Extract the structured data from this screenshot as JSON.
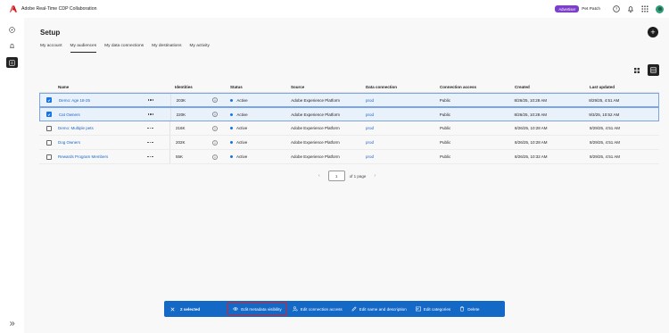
{
  "app": {
    "title": "Adobe Real-Time CDP Collaboration",
    "badge": "Advertiser",
    "org": "Pet Patch"
  },
  "page": {
    "title": "Setup",
    "tabs": [
      "My account",
      "My audiences",
      "My data connections",
      "My destinations",
      "My activity"
    ],
    "active_tab": "My audiences"
  },
  "table": {
    "headers": {
      "name": "Name",
      "identities": "Identities",
      "status": "Status",
      "source": "Source",
      "data_connection": "Data connection",
      "access": "Connection access",
      "created": "Created",
      "updated": "Last updated"
    },
    "rows": [
      {
        "name": "Demo: Age 18-25",
        "identities": "203K",
        "status": "Active",
        "source": "Adobe Experience Platform",
        "conn": "prod",
        "access": "Public",
        "created": "8/26/25, 10:28 AM",
        "updated": "8/29/25, 4:51 AM",
        "selected": true
      },
      {
        "name": "Cat Owners",
        "identities": "220K",
        "status": "Active",
        "source": "Adobe Experience Platform",
        "conn": "prod",
        "access": "Public",
        "created": "8/26/25, 10:28 AM",
        "updated": "9/3/25, 10:52 AM",
        "selected": true
      },
      {
        "name": "Demo: Multiple pets",
        "identities": "216K",
        "status": "Active",
        "source": "Adobe Experience Platform",
        "conn": "prod",
        "access": "Public",
        "created": "8/26/25, 10:28 AM",
        "updated": "8/29/25, 4:51 AM",
        "selected": false
      },
      {
        "name": "Dog Owners",
        "identities": "202K",
        "status": "Active",
        "source": "Adobe Experience Platform",
        "conn": "prod",
        "access": "Public",
        "created": "8/26/25, 10:28 AM",
        "updated": "8/29/25, 4:51 AM",
        "selected": false
      },
      {
        "name": "Rewards Program Members",
        "identities": "55K",
        "status": "Active",
        "source": "Adobe Experience Platform",
        "conn": "prod",
        "access": "Public",
        "created": "8/26/25, 10:32 AM",
        "updated": "8/29/25, 4:51 AM",
        "selected": false
      }
    ]
  },
  "pagination": {
    "current": "1",
    "of_label": "of 1 page"
  },
  "actionbar": {
    "selected": "2 selected",
    "edit_metadata": "Edit metadata visibility",
    "edit_access": "Edit connection access",
    "edit_name": "Edit name and description",
    "edit_categories": "Edit categories",
    "delete": "Delete"
  },
  "colors": {
    "accent": "#1473e6",
    "actionbar": "#1469c7",
    "badge": "#7c3fc9",
    "highlight": "#d9212b"
  }
}
